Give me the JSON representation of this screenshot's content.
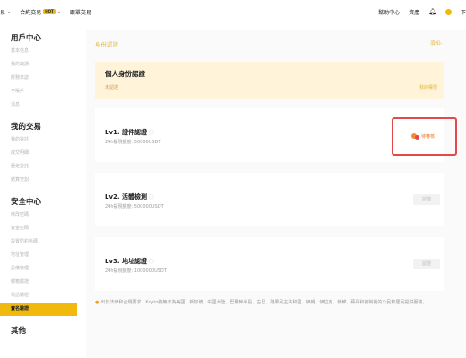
{
  "topbar": {
    "nav": [
      {
        "label": "易",
        "chev": "⌄",
        "hot": ""
      },
      {
        "label": "合約交易",
        "chev": "⌄",
        "hot": "HOT"
      },
      {
        "label": "跟單交易",
        "chev": "",
        "hot": ""
      }
    ],
    "help": "幫助中心",
    "assets": "資產",
    "download": "下"
  },
  "sidebar": {
    "groups": [
      {
        "title": "用戶中心",
        "items": [
          "基本信息",
          "我的邀請",
          "財務日誌",
          "子賬戶",
          "消息"
        ]
      },
      {
        "title": "我的交易",
        "items": [
          "我的委託",
          "成交明細",
          "歷史委託",
          "結算交割"
        ]
      },
      {
        "title": "安全中心",
        "items": [
          "修改密碼",
          "資金密碼",
          "設置防釣魚碼",
          "地址管理",
          "設備管理",
          "郵箱驗證",
          "電話驗證",
          "實名驗證"
        ]
      },
      {
        "title": "其他",
        "items": []
      }
    ],
    "active_item": "實名驗證"
  },
  "main": {
    "title": "身份認證",
    "help": "須知›"
  },
  "identity": {
    "title": "個人身份認證",
    "status": "未認證",
    "link": "我的權限"
  },
  "levels": [
    {
      "title": "Lv1. 證件認證",
      "limit": "24h提現額度: 50000USDT",
      "action": "待審核",
      "state": "review"
    },
    {
      "title": "Lv2. 活體檢測",
      "limit": "24h提現額度: 500000USDT",
      "action": "認證",
      "state": "button"
    },
    {
      "title": "Lv3. 地址認證",
      "limit": "24h提現額度: 1000000USDT",
      "action": "認證",
      "state": "button"
    }
  ],
  "notice": "出於法律和合規要求，Kcyto將無法為美國、新加坡、中國大陸、巴爾幹半島、古巴、剛果民主共和國、伊朗、伊拉克、朝鮮、蘇丹和被制裁的公民和居民提供服務。",
  "colors": {
    "accent": "#f0b90b",
    "highlight": "#e24a4a",
    "warning": "#e8772e"
  }
}
